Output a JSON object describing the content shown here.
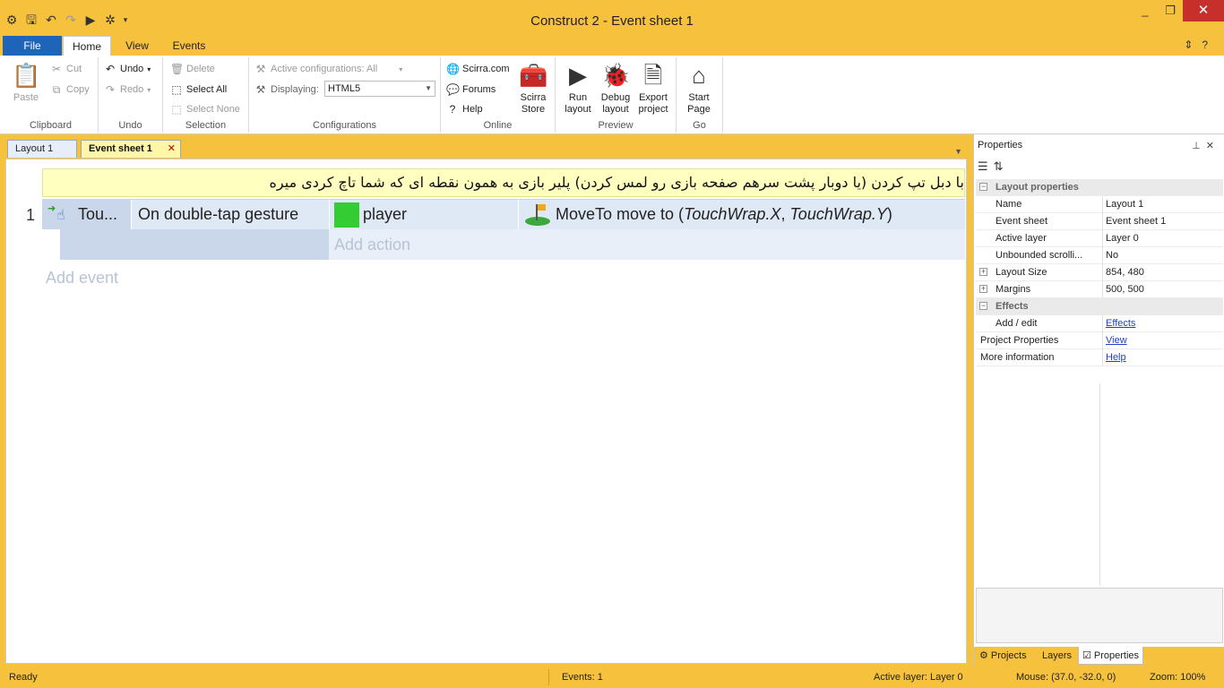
{
  "window": {
    "title": "Construct 2 - Event sheet 1"
  },
  "ribbon": {
    "tabs": {
      "file": "File",
      "home": "Home",
      "view": "View",
      "events": "Events"
    },
    "clipboard": {
      "paste": "Paste",
      "cut": "Cut",
      "copy": "Copy",
      "label": "Clipboard"
    },
    "undo": {
      "undo": "Undo",
      "redo": "Redo",
      "label": "Undo"
    },
    "selection": {
      "delete": "Delete",
      "select_all": "Select All",
      "select_none": "Select None",
      "label": "Selection"
    },
    "configurations": {
      "active_configs": "Active configurations: All",
      "displaying_label": "Displaying:",
      "displaying_value": "HTML5",
      "label": "Configurations"
    },
    "online": {
      "scirra": "Scirra.com",
      "forums": "Forums",
      "help": "Help",
      "store_line1": "Scirra",
      "store_line2": "Store",
      "label": "Online"
    },
    "preview": {
      "run_line1": "Run",
      "run_line2": "layout",
      "debug_line1": "Debug",
      "debug_line2": "layout",
      "export_line1": "Export",
      "export_line2": "project",
      "label": "Preview"
    },
    "go": {
      "start_line1": "Start",
      "start_line2": "Page",
      "label": "Go"
    }
  },
  "doc_tabs": [
    {
      "label": "Layout 1"
    },
    {
      "label": "Event sheet 1"
    }
  ],
  "event_sheet": {
    "comment": "با دبل تپ کردن (یا دوبار پشت سرهم صفحه بازی رو لمس کردن) پلیر بازی به همون نقطه ای که شما تاچ کردی میره",
    "events": [
      {
        "number": "1",
        "condition_object": "Tou...",
        "condition_text": "On double-tap gesture",
        "action_object": "player",
        "action_name": "MoveTo move to (",
        "action_param1": "TouchWrap.X",
        "action_sep": ", ",
        "action_param2": "TouchWrap.Y",
        "action_close": ")"
      }
    ],
    "add_action": "Add action",
    "add_event": "Add event"
  },
  "properties": {
    "title": "Properties",
    "rows": [
      {
        "kind": "cat",
        "toggle": "−",
        "name": "Layout properties"
      },
      {
        "kind": "prop",
        "name": "Name",
        "value": "Layout 1"
      },
      {
        "kind": "prop",
        "name": "Event sheet",
        "value": "Event sheet 1"
      },
      {
        "kind": "prop",
        "name": "Active layer",
        "value": "Layer 0"
      },
      {
        "kind": "prop",
        "name": "Unbounded scrolli...",
        "value": "No"
      },
      {
        "kind": "prop",
        "toggle": "+",
        "name": "Layout Size",
        "value": "854, 480"
      },
      {
        "kind": "prop",
        "toggle": "+",
        "name": "Margins",
        "value": "500, 500"
      },
      {
        "kind": "cat",
        "toggle": "−",
        "name": "Effects"
      },
      {
        "kind": "prop",
        "name": "Add / edit",
        "value": "Effects",
        "link": true
      },
      {
        "kind": "root",
        "name": "Project Properties",
        "value": "View",
        "link": true
      },
      {
        "kind": "root",
        "name": "More information",
        "value": "Help",
        "link": true
      }
    ],
    "bottom_tabs": {
      "projects": "Projects",
      "layers": "Layers",
      "properties": "Properties"
    }
  },
  "status": {
    "ready": "Ready",
    "events": "Events: 1",
    "active_layer": "Active layer: Layer 0",
    "mouse": "Mouse: (37.0, -32.0, 0)",
    "zoom": "Zoom: 100%"
  }
}
